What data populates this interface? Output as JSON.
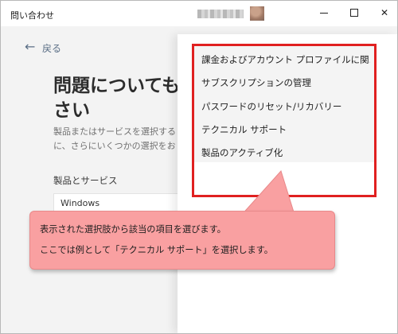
{
  "window": {
    "title": "問い合わせ",
    "controls": {
      "minimize": "minimize",
      "maximize": "maximize",
      "close": "✕"
    }
  },
  "page": {
    "back_label": "戻る",
    "heading_line1": "問題についても",
    "heading_line2": "さい",
    "desc_line1": "製品またはサービスを選択する",
    "desc_line2": "に、さらにいくつかの選択をお",
    "product_label": "製品とサービス",
    "product_value": "Windows"
  },
  "menu": {
    "items": [
      "課金およびアカウント プロファイルに関...",
      "サブスクリプションの管理",
      "パスワードのリセット/リカバリー",
      "テクニカル サポート",
      "製品のアクティブ化"
    ]
  },
  "callout": {
    "line1": "表示された選択肢から該当の項目を選びます。",
    "line2": "ここでは例として「テクニカル サポート」を選択します。"
  },
  "colors": {
    "highlight_border": "#e02020",
    "callout_fill": "#f9a0a1",
    "link_blue": "#5b6f86"
  }
}
